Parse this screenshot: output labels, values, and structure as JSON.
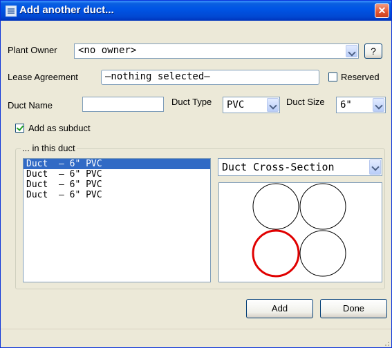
{
  "window": {
    "title": "Add another duct...",
    "close_glyph": "✕"
  },
  "plant_owner": {
    "label": "Plant Owner",
    "value": "<no owner>",
    "help_label": "?"
  },
  "lease": {
    "label": "Lease Agreement",
    "value": "–nothing selected–",
    "reserved_label": "Reserved",
    "reserved_checked": false
  },
  "duct": {
    "name_label": "Duct Name",
    "name_value": "",
    "type_label": "Duct Type",
    "type_value": "PVC",
    "size_label": "Duct Size",
    "size_value": "6\""
  },
  "subduct": {
    "label": "Add as subduct",
    "checked": true
  },
  "group": {
    "legend": "... in this duct",
    "items": [
      "Duct  – 6\" PVC",
      "Duct  – 6\" PVC",
      "Duct  – 6\" PVC",
      "Duct  – 6\" PVC"
    ],
    "selected_index": 0
  },
  "cross_section": {
    "dropdown_value": "Duct Cross-Section",
    "circles": [
      {
        "highlighted": false
      },
      {
        "highlighted": false
      },
      {
        "highlighted": true
      },
      {
        "highlighted": false
      }
    ],
    "normal_color": "#000000",
    "highlight_color": "#e00000"
  },
  "buttons": {
    "add_label": "Add",
    "done_label": "Done"
  },
  "icons": {
    "title": "window-list-icon",
    "dropdown": "chevron-down-icon",
    "check": "checkmark-icon",
    "grip": "resize-grip-icon"
  }
}
